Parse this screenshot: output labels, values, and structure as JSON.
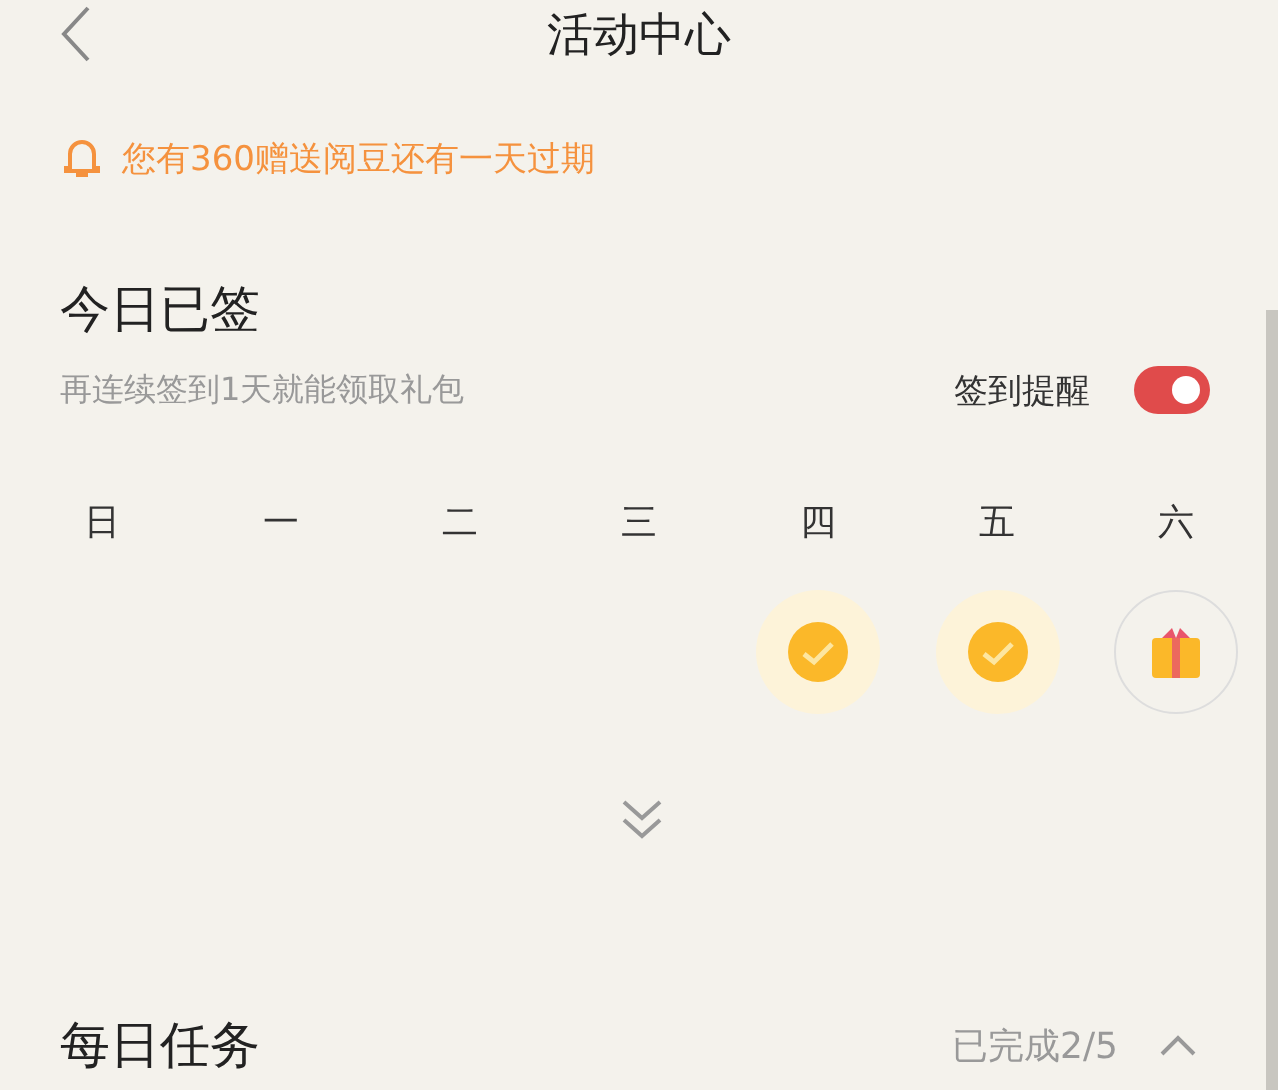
{
  "header": {
    "title": "活动中心"
  },
  "notice": {
    "text": "您有360赠送阅豆还有一天过期"
  },
  "checkin": {
    "title": "今日已签",
    "subtitle": "再连续签到1天就能领取礼包",
    "reminder_label": "签到提醒",
    "reminder_on": true,
    "days": [
      {
        "label": "日",
        "kind": "empty"
      },
      {
        "label": "一",
        "kind": "empty"
      },
      {
        "label": "二",
        "kind": "empty"
      },
      {
        "label": "三",
        "kind": "empty"
      },
      {
        "label": "四",
        "kind": "checked"
      },
      {
        "label": "五",
        "kind": "checked"
      },
      {
        "label": "六",
        "kind": "gift"
      }
    ]
  },
  "tasks": {
    "title": "每日任务",
    "progress": "已完成2/5",
    "expanded": true
  }
}
